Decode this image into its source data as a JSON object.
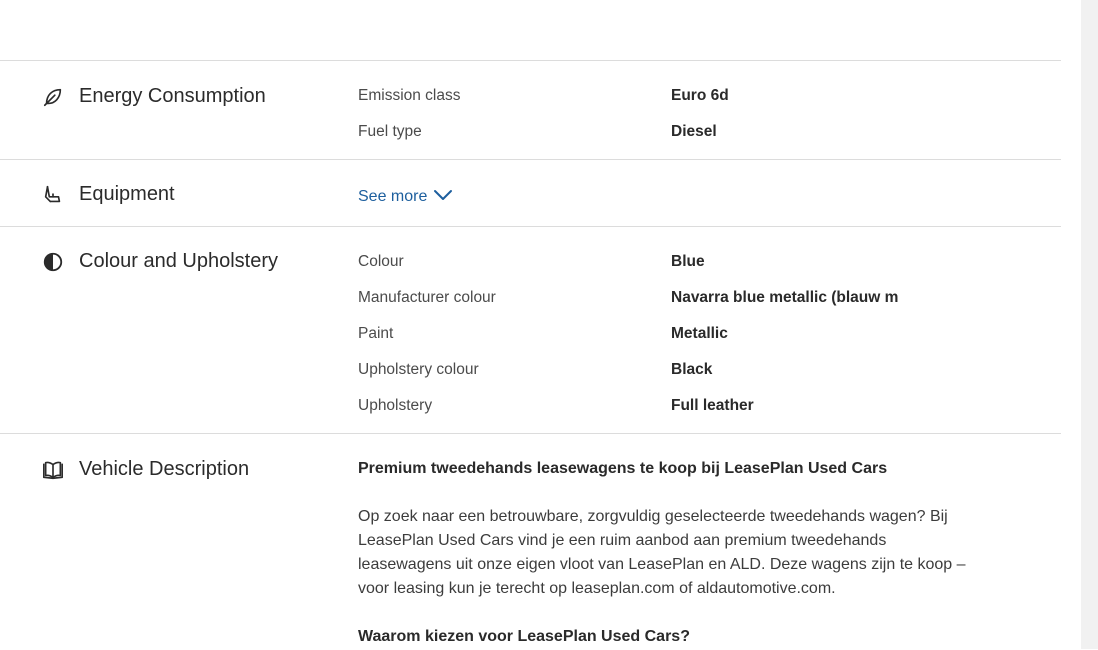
{
  "energy": {
    "title": "Energy Consumption",
    "icon": "leaf-icon",
    "rows": [
      {
        "label": "Emission class",
        "value": "Euro 6d"
      },
      {
        "label": "Fuel type",
        "value": "Diesel"
      }
    ]
  },
  "equipment": {
    "title": "Equipment",
    "icon": "seat-icon",
    "see_more_label": "See more"
  },
  "colour": {
    "title": "Colour and Upholstery",
    "icon": "half-circle-icon",
    "rows": [
      {
        "label": "Colour",
        "value": "Blue"
      },
      {
        "label": "Manufacturer colour",
        "value": "Navarra blue metallic (blauw m"
      },
      {
        "label": "Paint",
        "value": "Metallic"
      },
      {
        "label": "Upholstery colour",
        "value": "Black"
      },
      {
        "label": "Upholstery",
        "value": "Full leather"
      }
    ]
  },
  "description": {
    "title": "Vehicle Description",
    "icon": "open-book-icon",
    "heading": "Premium tweedehands leasewagens te koop bij LeasePlan Used Cars",
    "paragraph": "Op zoek naar een betrouwbare, zorgvuldig geselecteerde tweedehands wagen? Bij LeasePlan Used Cars vind je een ruim aanbod aan premium tweedehands leasewagens uit onze eigen vloot van LeasePlan en ALD. Deze wagens zijn te koop – voor leasing kun je terecht op leaseplan.com of aldautomotive.com.",
    "subheading": "Waarom kiezen voor LeasePlan Used Cars?"
  },
  "colors": {
    "link": "#1d5f9e",
    "divider": "#dcdcdc",
    "text": "#3c3c3c"
  }
}
